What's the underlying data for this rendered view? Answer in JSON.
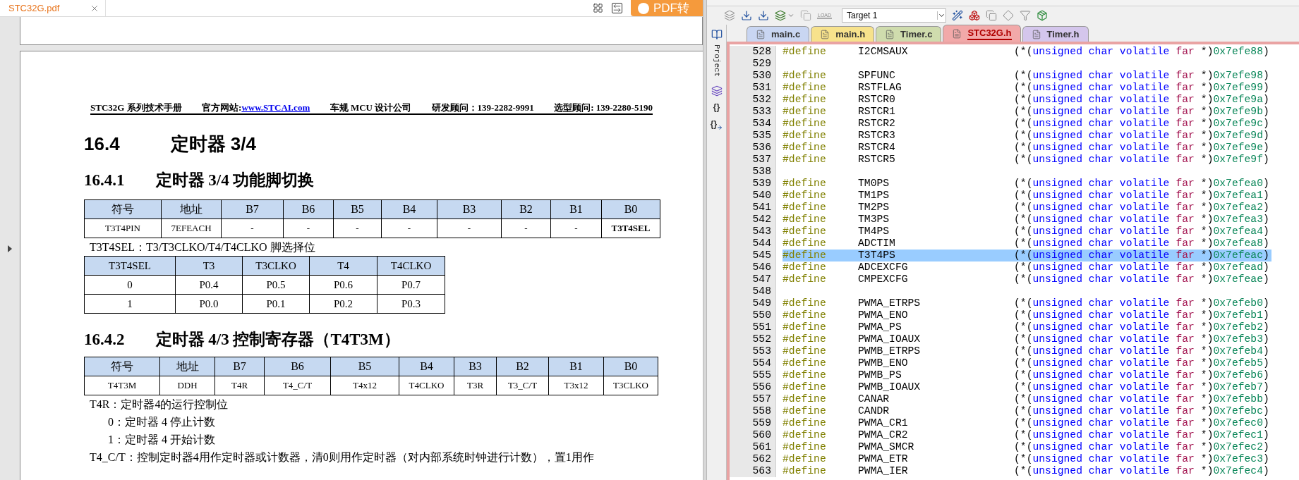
{
  "pdf_viewer": {
    "tab": {
      "title": "STC32G.pdf",
      "selected": true
    },
    "convert_button": "PDF转",
    "page_header": {
      "series": "STC32G 系列技术手册",
      "site_label": "官方网站: ",
      "site_link": "www.STCAI.com",
      "company": "车规 MCU 设计公司",
      "rd_contact": "研发顾问：139-2282-9991",
      "sales_contact": "选型顾问: 139-2280-5190"
    },
    "blocks": [
      {
        "kind": "h1",
        "number": "16.4",
        "title": "定时器 3/4"
      },
      {
        "kind": "h2",
        "number": "16.4.1",
        "title": "定时器 3/4 功能脚切换"
      },
      {
        "kind": "register_table",
        "columns": [
          "符号",
          "地址",
          "B7",
          "B6",
          "B5",
          "B4",
          "B3",
          "B2",
          "B1",
          "B0"
        ],
        "cells": [
          {
            "text": "T3T4PIN",
            "bold": false
          },
          {
            "text": "7EFEACH",
            "bold": false
          },
          {
            "text": "-",
            "bold": false
          },
          {
            "text": "-",
            "bold": false
          },
          {
            "text": "-",
            "bold": false
          },
          {
            "text": "-",
            "bold": false
          },
          {
            "text": "-",
            "bold": false
          },
          {
            "text": "-",
            "bold": false
          },
          {
            "text": "-",
            "bold": false
          },
          {
            "text": "T3T4SEL",
            "bold": true
          }
        ]
      },
      {
        "kind": "paragraph",
        "text": "T3T4SEL：T3/T3CLKO/T4/T4CLKO 脚选择位"
      },
      {
        "kind": "option_table",
        "columns": [
          "T3T4SEL",
          "T3",
          "T3CLKO",
          "T4",
          "T4CLKO"
        ],
        "rows": [
          [
            "0",
            "P0.4",
            "P0.5",
            "P0.6",
            "P0.7"
          ],
          [
            "1",
            "P0.0",
            "P0.1",
            "P0.2",
            "P0.3"
          ]
        ]
      },
      {
        "kind": "h2",
        "number": "16.4.2",
        "title": "定时器 4/3 控制寄存器（T4T3M）"
      },
      {
        "kind": "register_table",
        "columns": [
          "符号",
          "地址",
          "B7",
          "B6",
          "B5",
          "B4",
          "B3",
          "B2",
          "B1",
          "B0"
        ],
        "cells": [
          {
            "text": "T4T3M",
            "bold": false
          },
          {
            "text": "DDH",
            "bold": false
          },
          {
            "text": "T4R",
            "bold": false
          },
          {
            "text": "T4_C/T",
            "bold": false
          },
          {
            "text": "T4x12",
            "bold": false
          },
          {
            "text": "T4CLKO",
            "bold": false
          },
          {
            "text": "T3R",
            "bold": false
          },
          {
            "text": "T3_C/T",
            "bold": false
          },
          {
            "text": "T3x12",
            "bold": false
          },
          {
            "text": "T3CLKO",
            "bold": false
          }
        ]
      },
      {
        "kind": "paragraph",
        "text": "T4R：定时器4的运行控制位"
      },
      {
        "kind": "option",
        "text": "0：定时器 4 停止计数"
      },
      {
        "kind": "option",
        "text": "1：定时器 4 开始计数"
      },
      {
        "kind": "paragraph",
        "text": "T4_C/T：控制定时器4用作定时器或计数器，清0则用作定时器（对内部系统时钟进行计数），置1用作"
      }
    ]
  },
  "ide": {
    "toolbar": {
      "load_label": "LOAD",
      "target": "Target 1"
    },
    "side_panel": {
      "label": "Project",
      "glyphs": [
        "{}",
        "{}"
      ]
    },
    "tabs": [
      {
        "label": "main.c",
        "color": "#c9d6f2",
        "selected": false
      },
      {
        "label": "main.h",
        "color": "#f7e28c",
        "selected": false
      },
      {
        "label": "Timer.c",
        "color": "#cfdcad",
        "selected": false
      },
      {
        "label": "STC32G.h",
        "color": "#f2a9a9",
        "selected": true
      },
      {
        "label": "Timer.h",
        "color": "#d4c6ec",
        "selected": false
      }
    ],
    "lines": [
      {
        "n": "528",
        "kind": "define",
        "directive": "#define",
        "name": "I2CMSAUX",
        "expr": [
          "(*(",
          "unsigned char volatile",
          "far",
          "*)",
          "0x7efe88",
          ")"
        ],
        "selected": false
      },
      {
        "n": "529",
        "kind": "blank",
        "selected": false
      },
      {
        "n": "530",
        "kind": "define",
        "directive": "#define",
        "name": "SPFUNC",
        "expr": [
          "(*(",
          "unsigned char volatile",
          "far",
          "*)",
          "0x7efe98",
          ")"
        ],
        "selected": false
      },
      {
        "n": "531",
        "kind": "define",
        "directive": "#define",
        "name": "RSTFLAG",
        "expr": [
          "(*(",
          "unsigned char volatile",
          "far",
          "*)",
          "0x7efe99",
          ")"
        ],
        "selected": false
      },
      {
        "n": "532",
        "kind": "define",
        "directive": "#define",
        "name": "RSTCR0",
        "expr": [
          "(*(",
          "unsigned char volatile",
          "far",
          "*)",
          "0x7efe9a",
          ")"
        ],
        "selected": false
      },
      {
        "n": "533",
        "kind": "define",
        "directive": "#define",
        "name": "RSTCR1",
        "expr": [
          "(*(",
          "unsigned char volatile",
          "far",
          "*)",
          "0x7efe9b",
          ")"
        ],
        "selected": false
      },
      {
        "n": "534",
        "kind": "define",
        "directive": "#define",
        "name": "RSTCR2",
        "expr": [
          "(*(",
          "unsigned char volatile",
          "far",
          "*)",
          "0x7efe9c",
          ")"
        ],
        "selected": false
      },
      {
        "n": "535",
        "kind": "define",
        "directive": "#define",
        "name": "RSTCR3",
        "expr": [
          "(*(",
          "unsigned char volatile",
          "far",
          "*)",
          "0x7efe9d",
          ")"
        ],
        "selected": false
      },
      {
        "n": "536",
        "kind": "define",
        "directive": "#define",
        "name": "RSTCR4",
        "expr": [
          "(*(",
          "unsigned char volatile",
          "far",
          "*)",
          "0x7efe9e",
          ")"
        ],
        "selected": false
      },
      {
        "n": "537",
        "kind": "define",
        "directive": "#define",
        "name": "RSTCR5",
        "expr": [
          "(*(",
          "unsigned char volatile",
          "far",
          "*)",
          "0x7efe9f",
          ")"
        ],
        "selected": false
      },
      {
        "n": "538",
        "kind": "blank",
        "selected": false
      },
      {
        "n": "539",
        "kind": "define",
        "directive": "#define",
        "name": "TM0PS",
        "expr": [
          "(*(",
          "unsigned char volatile",
          "far",
          "*)",
          "0x7efea0",
          ")"
        ],
        "selected": false
      },
      {
        "n": "540",
        "kind": "define",
        "directive": "#define",
        "name": "TM1PS",
        "expr": [
          "(*(",
          "unsigned char volatile",
          "far",
          "*)",
          "0x7efea1",
          ")"
        ],
        "selected": false
      },
      {
        "n": "541",
        "kind": "define",
        "directive": "#define",
        "name": "TM2PS",
        "expr": [
          "(*(",
          "unsigned char volatile",
          "far",
          "*)",
          "0x7efea2",
          ")"
        ],
        "selected": false
      },
      {
        "n": "542",
        "kind": "define",
        "directive": "#define",
        "name": "TM3PS",
        "expr": [
          "(*(",
          "unsigned char volatile",
          "far",
          "*)",
          "0x7efea3",
          ")"
        ],
        "selected": false
      },
      {
        "n": "543",
        "kind": "define",
        "directive": "#define",
        "name": "TM4PS",
        "expr": [
          "(*(",
          "unsigned char volatile",
          "far",
          "*)",
          "0x7efea4",
          ")"
        ],
        "selected": false
      },
      {
        "n": "544",
        "kind": "define",
        "directive": "#define",
        "name": "ADCTIM",
        "expr": [
          "(*(",
          "unsigned char volatile",
          "far",
          "*)",
          "0x7efea8",
          ")"
        ],
        "selected": false
      },
      {
        "n": "545",
        "kind": "define",
        "directive": "#define",
        "name": "T3T4PS",
        "expr": [
          "(*(",
          "unsigned char volatile",
          "far",
          "*)",
          "0x7efeac",
          ")"
        ],
        "selected": true
      },
      {
        "n": "546",
        "kind": "define",
        "directive": "#define",
        "name": "ADCEXCFG",
        "expr": [
          "(*(",
          "unsigned char volatile",
          "far",
          "*)",
          "0x7efead",
          ")"
        ],
        "selected": false
      },
      {
        "n": "547",
        "kind": "define",
        "directive": "#define",
        "name": "CMPEXCFG",
        "expr": [
          "(*(",
          "unsigned char volatile",
          "far",
          "*)",
          "0x7efeae",
          ")"
        ],
        "selected": false
      },
      {
        "n": "548",
        "kind": "blank",
        "selected": false
      },
      {
        "n": "549",
        "kind": "define",
        "directive": "#define",
        "name": "PWMA_ETRPS",
        "expr": [
          "(*(",
          "unsigned char volatile",
          "far",
          "*)",
          "0x7efeb0",
          ")"
        ],
        "selected": false
      },
      {
        "n": "550",
        "kind": "define",
        "directive": "#define",
        "name": "PWMA_ENO",
        "expr": [
          "(*(",
          "unsigned char volatile",
          "far",
          "*)",
          "0x7efeb1",
          ")"
        ],
        "selected": false
      },
      {
        "n": "551",
        "kind": "define",
        "directive": "#define",
        "name": "PWMA_PS",
        "expr": [
          "(*(",
          "unsigned char volatile",
          "far",
          "*)",
          "0x7efeb2",
          ")"
        ],
        "selected": false
      },
      {
        "n": "552",
        "kind": "define",
        "directive": "#define",
        "name": "PWMA_IOAUX",
        "expr": [
          "(*(",
          "unsigned char volatile",
          "far",
          "*)",
          "0x7efeb3",
          ")"
        ],
        "selected": false
      },
      {
        "n": "553",
        "kind": "define",
        "directive": "#define",
        "name": "PWMB_ETRPS",
        "expr": [
          "(*(",
          "unsigned char volatile",
          "far",
          "*)",
          "0x7efeb4",
          ")"
        ],
        "selected": false
      },
      {
        "n": "554",
        "kind": "define",
        "directive": "#define",
        "name": "PWMB_ENO",
        "expr": [
          "(*(",
          "unsigned char volatile",
          "far",
          "*)",
          "0x7efeb5",
          ")"
        ],
        "selected": false
      },
      {
        "n": "555",
        "kind": "define",
        "directive": "#define",
        "name": "PWMB_PS",
        "expr": [
          "(*(",
          "unsigned char volatile",
          "far",
          "*)",
          "0x7efeb6",
          ")"
        ],
        "selected": false
      },
      {
        "n": "556",
        "kind": "define",
        "directive": "#define",
        "name": "PWMB_IOAUX",
        "expr": [
          "(*(",
          "unsigned char volatile",
          "far",
          "*)",
          "0x7efeb7",
          ")"
        ],
        "selected": false
      },
      {
        "n": "557",
        "kind": "define",
        "directive": "#define",
        "name": "CANAR",
        "expr": [
          "(*(",
          "unsigned char volatile",
          "far",
          "*)",
          "0x7efebb",
          ")"
        ],
        "selected": false
      },
      {
        "n": "558",
        "kind": "define",
        "directive": "#define",
        "name": "CANDR",
        "expr": [
          "(*(",
          "unsigned char volatile",
          "far",
          "*)",
          "0x7efebc",
          ")"
        ],
        "selected": false
      },
      {
        "n": "559",
        "kind": "define",
        "directive": "#define",
        "name": "PWMA_CR1",
        "expr": [
          "(*(",
          "unsigned char volatile",
          "far",
          "*)",
          "0x7efec0",
          ")"
        ],
        "selected": false
      },
      {
        "n": "560",
        "kind": "define",
        "directive": "#define",
        "name": "PWMA_CR2",
        "expr": [
          "(*(",
          "unsigned char volatile",
          "far",
          "*)",
          "0x7efec1",
          ")"
        ],
        "selected": false
      },
      {
        "n": "561",
        "kind": "define",
        "directive": "#define",
        "name": "PWMA_SMCR",
        "expr": [
          "(*(",
          "unsigned char volatile",
          "far",
          "*)",
          "0x7efec2",
          ")"
        ],
        "selected": false
      },
      {
        "n": "562",
        "kind": "define",
        "directive": "#define",
        "name": "PWMA_ETR",
        "expr": [
          "(*(",
          "unsigned char volatile",
          "far",
          "*)",
          "0x7efec3",
          ")"
        ],
        "selected": false
      },
      {
        "n": "563",
        "kind": "define",
        "directive": "#define",
        "name": "PWMA_IER",
        "expr": [
          "(*(",
          "unsigned char volatile",
          "far",
          "*)",
          "0x7efec4",
          ")"
        ],
        "selected": false
      }
    ]
  }
}
